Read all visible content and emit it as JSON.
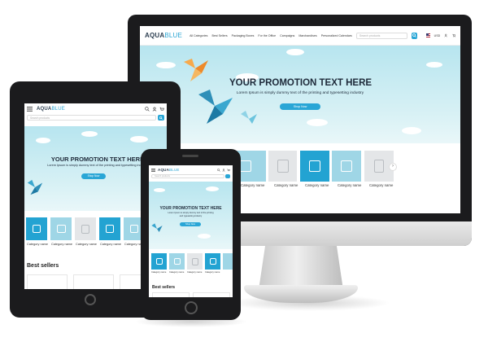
{
  "site": {
    "logo_part1": "AQUA",
    "logo_part2": "BLUE"
  },
  "desktop": {
    "nav": [
      "All Categories",
      "Best Sellers",
      "Packaging Boxes",
      "For the Office",
      "Campaigns",
      "Marchandises",
      "Personalized Calendars"
    ],
    "search_placeholder": "Search products",
    "language": "USD",
    "promo_title": "YOUR PROMOTION TEXT HERE",
    "promo_subtitle": "Lorem Ipsum is simply dummy text of the printing and typesetting industry",
    "shop_button": "Shop Now",
    "categories": [
      "Category name",
      "Category name",
      "Category name",
      "Category name",
      "Category name"
    ]
  },
  "tablet": {
    "search_placeholder": "Search products",
    "promo_title": "YOUR PROMOTION TEXT HERE",
    "promo_subtitle": "Lorem Ipsum is simply dummy text of the printing and typesetting industry",
    "shop_button": "Shop Now",
    "categories": [
      "Category name",
      "Category name",
      "Category name",
      "Category name",
      "Category name"
    ],
    "bestsellers": "Best sellers"
  },
  "phone": {
    "search_placeholder": "Search products",
    "promo_title": "YOUR PROMOTION TEXT HERE",
    "promo_subtitle_1": "Lorem Ipsum is simply dummy text of the printing",
    "promo_subtitle_2": "and typesetting industry",
    "shop_button": "Shop Now",
    "categories": [
      "Category name",
      "Category name",
      "Category name",
      "Category name"
    ],
    "bestsellers": "Best sellers"
  },
  "colors": {
    "accent": "#29a6d6",
    "bezel": "#1b1b1d",
    "hero_sky": "#c9ecf3"
  }
}
